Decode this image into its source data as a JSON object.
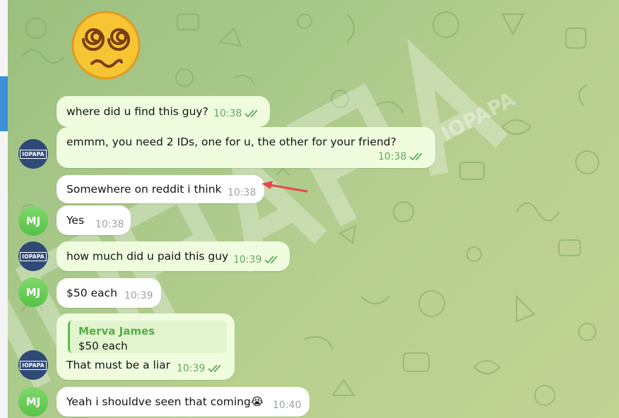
{
  "messages": [
    {
      "text": "where did u find this guy?",
      "time": "10:38",
      "read": true
    },
    {
      "text": "emmm, you need 2 IDs, one for u, the other for your friend?",
      "time": "10:38",
      "read": true
    },
    {
      "text": "Somewhere on reddit i think",
      "time": "10:38"
    },
    {
      "text": "Yes",
      "time": "10:38"
    },
    {
      "text": "how much did u paid this guy",
      "time": "10:39",
      "read": true
    },
    {
      "text": "$50 each",
      "time": "10:39"
    },
    {
      "reply_name": "Merva James",
      "reply_text": "$50 each",
      "text": "That must be a liar",
      "time": "10:39",
      "read": true
    },
    {
      "text": "Yeah i shouldve seen that coming",
      "emoji": "😭",
      "time": "10:40"
    }
  ],
  "avatars": {
    "iopapa_label": "IOPAPA",
    "mj_initials": "MJ"
  },
  "watermark": "IOPAPA",
  "colors": {
    "outgoing_bubble": "#effdde",
    "incoming_bubble": "#ffffff",
    "avatar_mj": "#57c247",
    "avatar_iopapa": "#2f4a76",
    "accent": "#3d92d6",
    "arrow": "#e5484d"
  },
  "icons": [
    "dizzy-face-sticker",
    "double-check-icon",
    "loudly-crying-emoji",
    "red-arrow-annotation"
  ]
}
